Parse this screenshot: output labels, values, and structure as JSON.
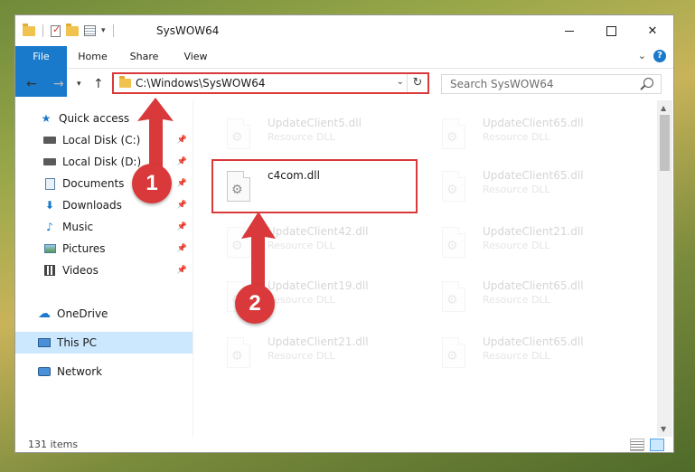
{
  "window": {
    "title": "SysWOW64"
  },
  "ribbon": {
    "tabs": [
      {
        "label": "File"
      },
      {
        "label": "Home"
      },
      {
        "label": "Share"
      },
      {
        "label": "View"
      }
    ]
  },
  "address": {
    "path": "C:\\Windows\\SysWOW64"
  },
  "search": {
    "placeholder": "Search SysWOW64"
  },
  "sidebar": {
    "items": [
      {
        "label": "Quick access",
        "icon": "star-icon"
      },
      {
        "label": "Local Disk (C:)",
        "icon": "drive-icon"
      },
      {
        "label": "Local Disk (D:)",
        "icon": "drive-icon"
      },
      {
        "label": "Documents",
        "icon": "documents-icon"
      },
      {
        "label": "Downloads",
        "icon": "download-icon"
      },
      {
        "label": "Music",
        "icon": "music-icon"
      },
      {
        "label": "Pictures",
        "icon": "pictures-icon"
      },
      {
        "label": "Videos",
        "icon": "videos-icon"
      },
      {
        "label": "OneDrive",
        "icon": "cloud-icon"
      },
      {
        "label": "This PC",
        "icon": "computer-icon"
      },
      {
        "label": "Network",
        "icon": "network-icon"
      }
    ]
  },
  "files": [
    {
      "name": "UpdateClient5.dll",
      "type": "Resource DLL"
    },
    {
      "name": "UpdateClient65.dll",
      "type": "Resource DLL"
    },
    {
      "name": "c4com.dll",
      "type": ""
    },
    {
      "name": "UpdateClient65.dll",
      "type": "Resource DLL"
    },
    {
      "name": "UpdateClient42.dll",
      "type": "Resource DLL"
    },
    {
      "name": "UpdateClient21.dll",
      "type": "Resource DLL"
    },
    {
      "name": "UpdateClient19.dll",
      "type": "Resource DLL"
    },
    {
      "name": "UpdateClient65.dll",
      "type": "Resource DLL"
    },
    {
      "name": "UpdateClient21.dll",
      "type": "Resource DLL"
    },
    {
      "name": "UpdateClient65.dll",
      "type": "Resource DLL"
    }
  ],
  "status": {
    "item_count": "131 items"
  },
  "annotations": {
    "step1": "1",
    "step2": "2",
    "color": "#d9393a"
  },
  "colors": {
    "accent": "#1979ca",
    "selection": "#cce8ff"
  }
}
